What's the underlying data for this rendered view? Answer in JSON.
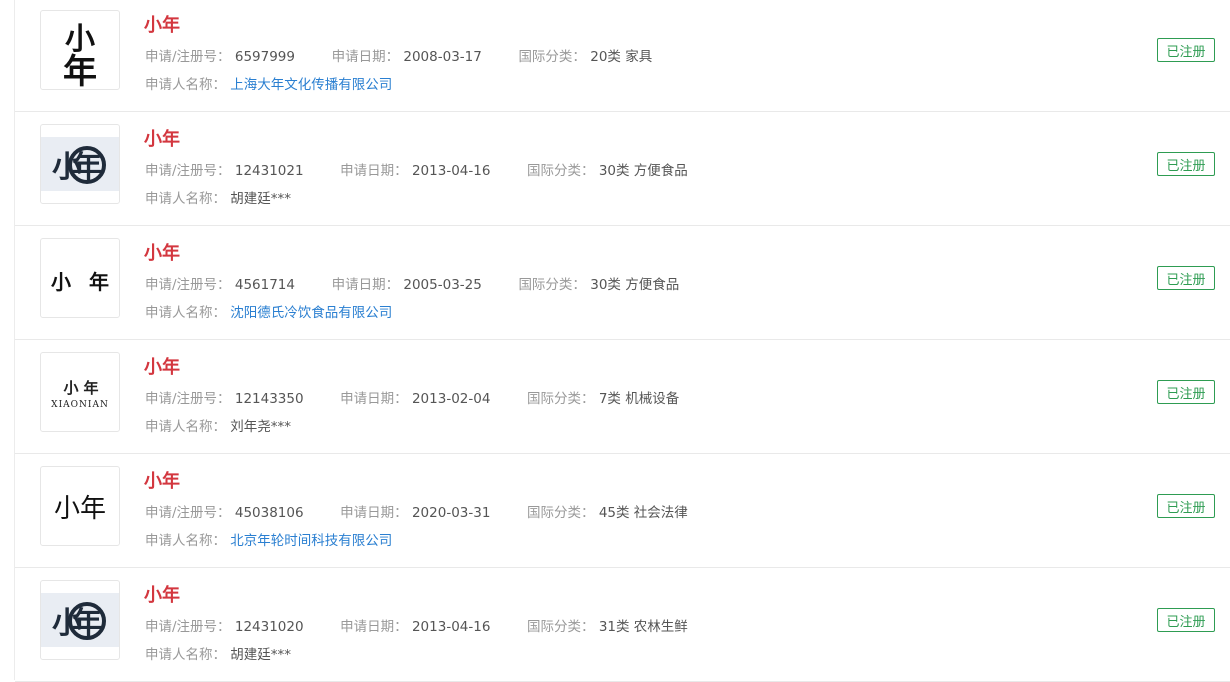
{
  "labels": {
    "reg_no": "申请/注册号：",
    "apply_date": "申请日期：",
    "intl_class": "国际分类：",
    "applicant": "申请人名称："
  },
  "colors": {
    "title": "#d3373f",
    "status": "#2e9c52",
    "link": "#2a7fd1"
  },
  "items": [
    {
      "name": "小年",
      "reg_no": "6597999",
      "apply_date": "2008-03-17",
      "intl_class": "20类 家具",
      "applicant": "上海大年文化传播有限公司",
      "applicant_is_link": true,
      "status": "已注册",
      "logo_style": "brush-vertical",
      "logo_text": [
        "小",
        "年"
      ]
    },
    {
      "name": "小年",
      "reg_no": "12431021",
      "apply_date": "2013-04-16",
      "intl_class": "30类 方便食品",
      "applicant": "胡建廷***",
      "applicant_is_link": false,
      "status": "已注册",
      "logo_style": "seal",
      "logo_text": [
        "小",
        "年"
      ]
    },
    {
      "name": "小年",
      "reg_no": "4561714",
      "apply_date": "2005-03-25",
      "intl_class": "30类 方便食品",
      "applicant": "沈阳德氏冷饮食品有限公司",
      "applicant_is_link": true,
      "status": "已注册",
      "logo_style": "spaced",
      "logo_text": [
        "小",
        "年"
      ]
    },
    {
      "name": "小年",
      "reg_no": "12143350",
      "apply_date": "2013-02-04",
      "intl_class": "7类 机械设备",
      "applicant": "刘年尧***",
      "applicant_is_link": false,
      "status": "已注册",
      "logo_style": "with-pinyin",
      "logo_text": [
        "小",
        "年"
      ],
      "logo_subtext": "XIAONIAN"
    },
    {
      "name": "小年",
      "reg_no": "45038106",
      "apply_date": "2020-03-31",
      "intl_class": "45类 社会法律",
      "applicant": "北京年轮时间科技有限公司",
      "applicant_is_link": true,
      "status": "已注册",
      "logo_style": "plain",
      "logo_text": [
        "小",
        "年"
      ]
    },
    {
      "name": "小年",
      "reg_no": "12431020",
      "apply_date": "2013-04-16",
      "intl_class": "31类 农林生鲜",
      "applicant": "胡建廷***",
      "applicant_is_link": false,
      "status": "已注册",
      "logo_style": "seal",
      "logo_text": [
        "小",
        "年"
      ]
    }
  ]
}
